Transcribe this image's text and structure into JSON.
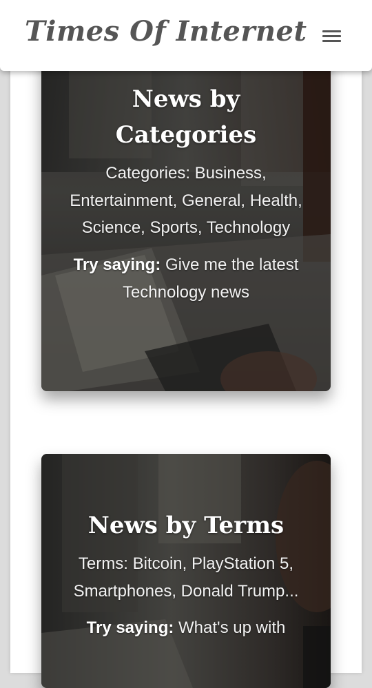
{
  "header": {
    "brand": "Times Of Internet",
    "menu_icon": "hamburger-menu-icon"
  },
  "cards": [
    {
      "title": "News by Categories",
      "description": "Categories: Business, Entertainment, General, Health, Science, Sports, Technology",
      "try_label": "Try saying:",
      "try_text": " Give me the latest Technology news",
      "background": "laptop-desk-photo"
    },
    {
      "title": "News by Terms",
      "description": "Terms: Bitcoin, PlayStation 5, Smartphones, Donald Trump...",
      "try_label": "Try saying:",
      "try_text": " What's up with",
      "background": "person-laptop-photo"
    }
  ],
  "colors": {
    "brand_text": "#555555",
    "card_text": "#ffffff",
    "page_background": "#ffffff"
  }
}
